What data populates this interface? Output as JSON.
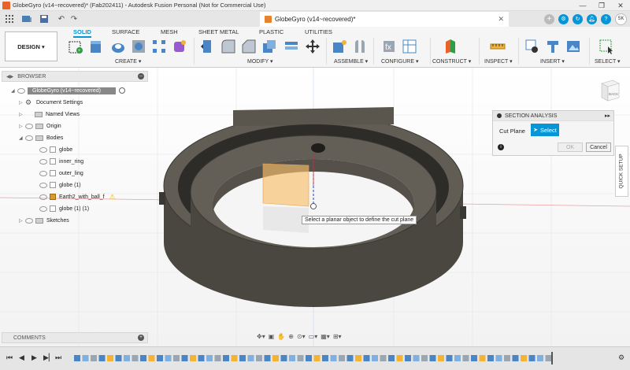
{
  "window": {
    "title": "GlobeGyro (v14~recovered)* (Fab202411) - Autodesk Fusion Personal (Not for Commercial Use)",
    "controls": [
      "—",
      "❐",
      "✕"
    ]
  },
  "doc_tab": {
    "title": "GlobeGyro (v14~recovered)*",
    "close": "✕"
  },
  "user": {
    "initials": "SK"
  },
  "ribbon": {
    "workspace": "DESIGN ▾",
    "tabs": [
      "SOLID",
      "SURFACE",
      "MESH",
      "SHEET METAL",
      "PLASTIC",
      "UTILITIES"
    ],
    "groups": [
      "CREATE ▾",
      "MODIFY ▾",
      "ASSEMBLE ▾",
      "CONFIGURE ▾",
      "CONSTRUCT ▾",
      "INSPECT ▾",
      "INSERT ▾",
      "SELECT ▾"
    ]
  },
  "browser": {
    "title": "BROWSER",
    "root": "GlobeGyro (v14~recovered)",
    "items": [
      {
        "label": "Document Settings"
      },
      {
        "label": "Named Views"
      },
      {
        "label": "Origin"
      },
      {
        "label": "Bodies"
      },
      {
        "label": "globe"
      },
      {
        "label": "inner_ring"
      },
      {
        "label": "outer_ling"
      },
      {
        "label": "globe (1)"
      },
      {
        "label": "Earth2_with_ball_f"
      },
      {
        "label": "globe (1) (1)"
      },
      {
        "label": "Sketches"
      }
    ]
  },
  "section_analysis": {
    "title": "SECTION ANALYSIS",
    "cut_plane_label": "Cut Plane",
    "select_label": "Select",
    "ok_label": "OK",
    "cancel_label": "Cancel",
    "info": "i"
  },
  "quick_setup": "QUICK SETUP",
  "viewcube_label": "BACK",
  "tooltip": "Select a planar object to define the cut plane",
  "comments": {
    "title": "COMMENTS"
  },
  "colors": {
    "accent": "#0696d7",
    "ring": "#5c5850",
    "ring_dark": "#3d3a35",
    "plane": "#f7be6a"
  }
}
